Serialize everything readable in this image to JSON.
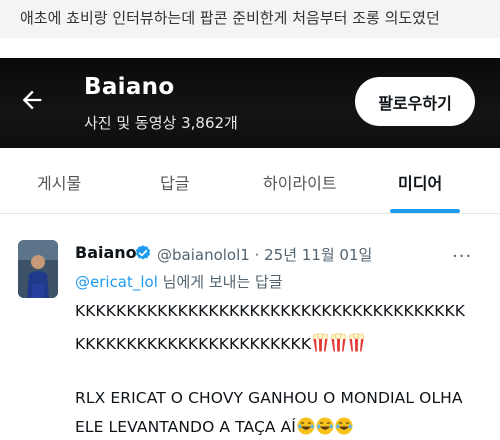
{
  "caption": "애초에 쵸비랑 인터뷰하는데 팝콘 준비한게 처음부터 조롱 의도였던",
  "header": {
    "name": "Baiano",
    "subtitle": "사진 및 동영상 3,862개",
    "follow_label": "팔로우하기"
  },
  "tabs": [
    {
      "label": "게시물"
    },
    {
      "label": "답글"
    },
    {
      "label": "하이라이트"
    },
    {
      "label": "미디어"
    }
  ],
  "tweet": {
    "name": "Baiano",
    "meta": "@baianolol1 · 25년 11월 01일",
    "reply_mention": "@ericat_lol",
    "reply_suffix": " 님에게 보내는 답글",
    "line1": "KKKKKKKKKKKKKKKKKKKKKKKKKKKKKKKKKKKKKK",
    "line2": "KKKKKKKKKKKKKKKKKKKKKKK",
    "line3": "RLX ERICAT O CHOVY GANHOU O MONDIAL OLHA",
    "line4": "ELE LEVANTANDO A TAÇA AÍ",
    "line2_emojis": [
      "popcorn-icon",
      "popcorn-icon",
      "popcorn-icon"
    ],
    "line4_emojis": [
      "laughing-face-icon",
      "laughing-face-icon",
      "laughing-face-icon"
    ]
  },
  "colors": {
    "accent": "#1d9bf0",
    "header_bg": "#0f0f0f",
    "muted_text": "#536471"
  }
}
